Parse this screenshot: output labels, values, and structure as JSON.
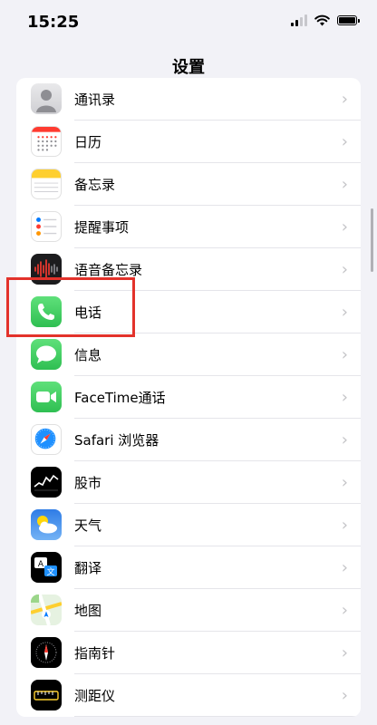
{
  "status": {
    "time": "15:25"
  },
  "nav": {
    "title": "设置"
  },
  "rows": [
    {
      "label": "通讯录",
      "icon": "contacts-icon"
    },
    {
      "label": "日历",
      "icon": "calendar-icon"
    },
    {
      "label": "备忘录",
      "icon": "notes-icon"
    },
    {
      "label": "提醒事项",
      "icon": "reminders-icon"
    },
    {
      "label": "语音备忘录",
      "icon": "voice-memos-icon"
    },
    {
      "label": "电话",
      "icon": "phone-icon"
    },
    {
      "label": "信息",
      "icon": "messages-icon"
    },
    {
      "label": "FaceTime通话",
      "icon": "facetime-icon"
    },
    {
      "label": "Safari 浏览器",
      "icon": "safari-icon"
    },
    {
      "label": "股市",
      "icon": "stocks-icon"
    },
    {
      "label": "天气",
      "icon": "weather-icon"
    },
    {
      "label": "翻译",
      "icon": "translate-icon"
    },
    {
      "label": "地图",
      "icon": "maps-icon"
    },
    {
      "label": "指南针",
      "icon": "compass-icon"
    },
    {
      "label": "测距仪",
      "icon": "measure-icon"
    }
  ],
  "colors": {
    "highlight": "#e3322b",
    "phone": "#34c759"
  }
}
